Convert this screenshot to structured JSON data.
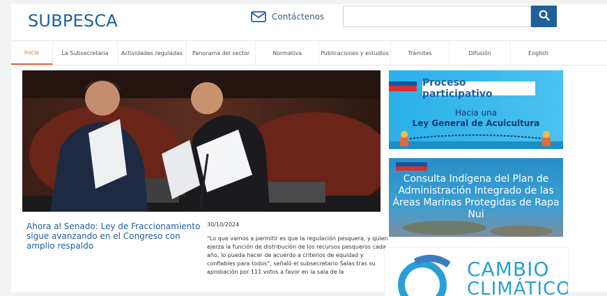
{
  "header": {
    "logo_text": "SUBPESCA",
    "contact_label": "Contáctenos",
    "search_placeholder": "",
    "brand_color": "#1f5f9c"
  },
  "nav": {
    "items": [
      {
        "label": "Inicio",
        "active": true
      },
      {
        "label": "La Subsecretaría",
        "active": false
      },
      {
        "label": "Actividades reguladas",
        "active": false
      },
      {
        "label": "Panorama del sector",
        "active": false
      },
      {
        "label": "Normativa",
        "active": false
      },
      {
        "label": "Publicaciones y estudios",
        "active": false
      },
      {
        "label": "Trámites",
        "active": false
      },
      {
        "label": "Difusión",
        "active": false
      },
      {
        "label": "English",
        "active": false
      }
    ],
    "active_color": "#e4683a"
  },
  "news": {
    "headline": "Ahora al Senado: Ley de Fraccionamiento sigue avanzando en el Congreso con amplio respaldo",
    "date": "30/10/2024",
    "summary": "“Lo que vamos a permitir es que la regulación pesquera, y quien ejerza la función de distribución de los recursos pesqueros cada año, lo pueda hacer de acuerdo a criterios de equidad y confiables para todos”, señaló el subsecretario Salas tras su aprobación por 111 votos a favor en la sala de la"
  },
  "banners": {
    "b1": {
      "title": "Proceso participativo",
      "line1": "Hacia una",
      "line2": "Ley General de Acuicultura"
    },
    "b2": {
      "text": "Consulta Indígena del Plan de Administración Integrado de las Áreas Marinas Protegidas de Rapa Nui"
    },
    "b3": {
      "line1": "CAMBIO",
      "line2": "CLIMÁTICO"
    }
  }
}
